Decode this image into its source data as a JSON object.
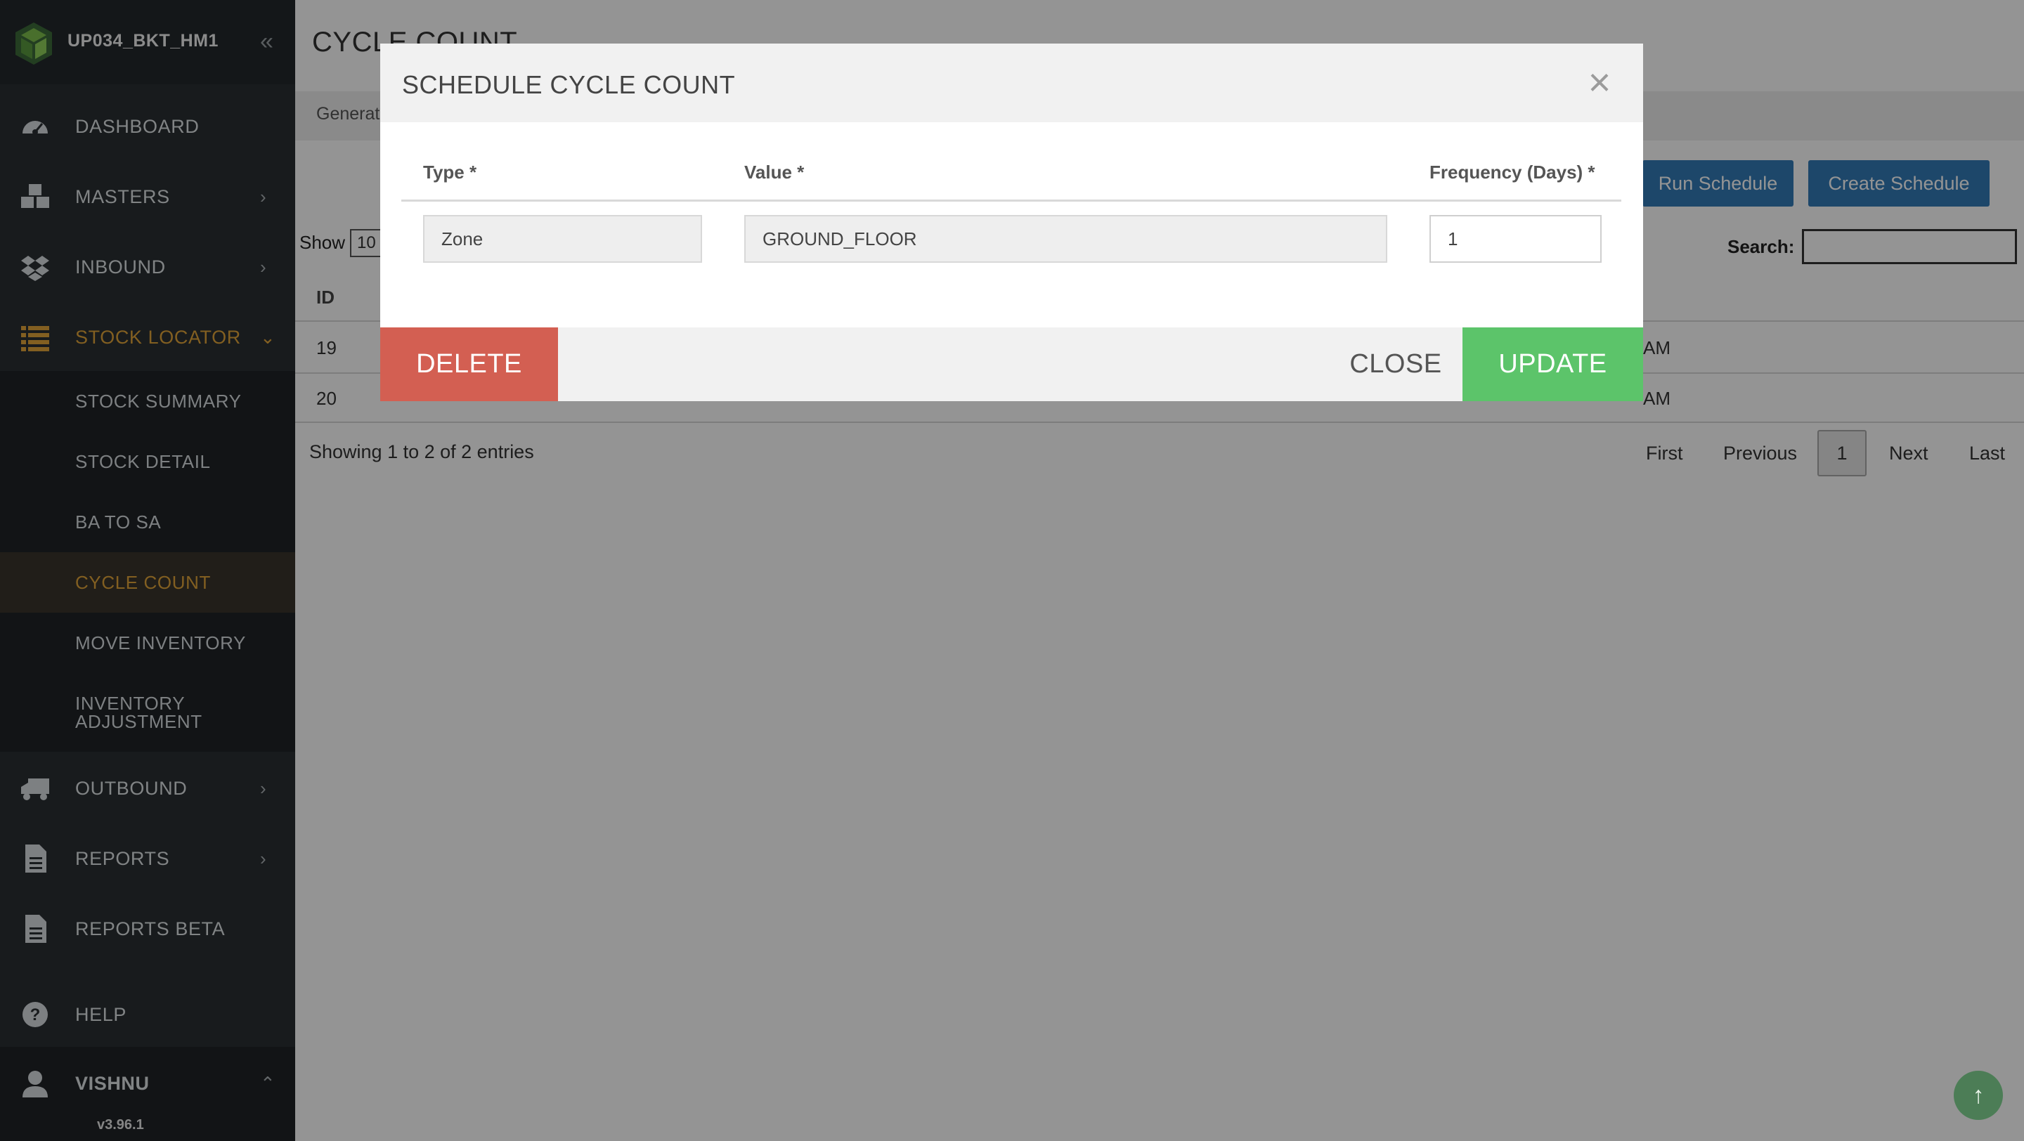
{
  "brand": {
    "name": "UP034_BKT_HM1",
    "collapse_glyph": "«"
  },
  "sidebar": {
    "items": [
      {
        "label": "DASHBOARD",
        "icon": "dashboard-icon"
      },
      {
        "label": "MASTERS",
        "icon": "cubes-icon",
        "chevron": "›"
      },
      {
        "label": "INBOUND",
        "icon": "dropbox-icon",
        "chevron": "›"
      },
      {
        "label": "STOCK LOCATOR",
        "icon": "list-icon",
        "chevron": "⌄",
        "active": true
      },
      {
        "label": "OUTBOUND",
        "icon": "truck-icon",
        "chevron": "›"
      },
      {
        "label": "REPORTS",
        "icon": "file-icon",
        "chevron": "›"
      },
      {
        "label": "REPORTS BETA",
        "icon": "file-icon"
      },
      {
        "label": "HELP",
        "icon": "question-circle-icon"
      }
    ],
    "submenu": [
      {
        "label": "STOCK SUMMARY"
      },
      {
        "label": "STOCK DETAIL"
      },
      {
        "label": "BA TO SA"
      },
      {
        "label": "CYCLE COUNT",
        "active": true
      },
      {
        "label": "MOVE INVENTORY"
      },
      {
        "label": "INVENTORY ADJUSTMENT"
      }
    ],
    "user": {
      "name": "VISHNU",
      "chevron": "⌃",
      "icon": "user-icon"
    },
    "version": "v3.96.1"
  },
  "main": {
    "title": "CYCLE COUNT",
    "tab_general": "Generat",
    "run_schedule": "Run Schedule",
    "create_schedule": "Create Schedule",
    "show_label": "Show",
    "show_value": "10",
    "search_label": "Search:",
    "th_id": "ID",
    "rows": [
      {
        "id": "19",
        "time_tail": "AM"
      },
      {
        "id": "20",
        "time_tail": "AM"
      }
    ],
    "showing": "Showing 1 to 2 of 2 entries",
    "pager": {
      "first": "First",
      "previous": "Previous",
      "current": "1",
      "next": "Next",
      "last": "Last"
    }
  },
  "modal": {
    "title": "SCHEDULE CYCLE COUNT",
    "close_glyph": "×",
    "columns": {
      "type": "Type *",
      "value": "Value *",
      "frequency": "Frequency (Days) *"
    },
    "type_value": "Zone",
    "value_value": "GROUND_FLOOR",
    "frequency_value": "1",
    "delete_label": "DELETE",
    "close_label": "CLOSE",
    "update_label": "UPDATE"
  },
  "scroll_top_glyph": "↑",
  "colors": {
    "sidebar_bg": "#2a2f33",
    "accent": "#e0a43a",
    "primary": "#337ab7",
    "danger": "#d35f52",
    "success": "#5cc46a"
  }
}
